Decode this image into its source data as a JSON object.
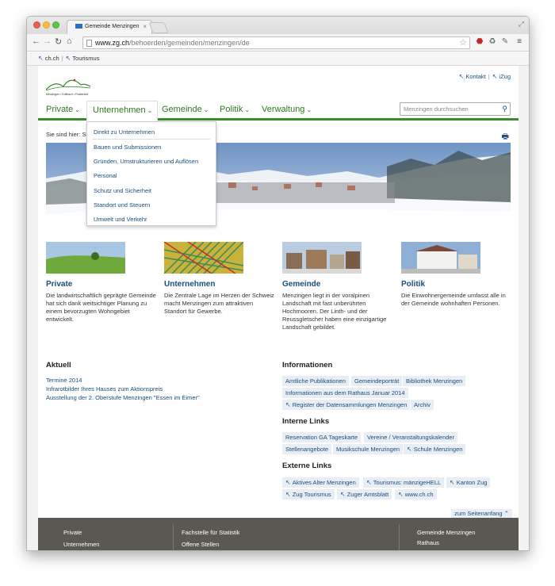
{
  "browser": {
    "tab_title": "Gemeinde Menzingen",
    "url_host": "www.zg.ch",
    "url_path": "/behoerden/gemeinden/menzingen/de"
  },
  "bookmarks": [
    {
      "label": "ch.ch"
    },
    {
      "label": "Tourismus"
    }
  ],
  "logo": {
    "text": "Menzingen • Edlibach • Finstersee"
  },
  "toplinks": [
    {
      "label": "Kontakt"
    },
    {
      "label": "iZug"
    }
  ],
  "nav": {
    "items": [
      {
        "label": "Private"
      },
      {
        "label": "Unternehmen"
      },
      {
        "label": "Gemeinde"
      },
      {
        "label": "Politik"
      },
      {
        "label": "Verwaltung"
      }
    ],
    "search_placeholder": "Menzingen durchsuchen"
  },
  "breadcrumb": "Sie sind hier: S",
  "dropdown": {
    "items": [
      "Direkt zu Unternehmen",
      "Bauen und Submissionen",
      "Gründen, Umstrukturieren und Auflösen",
      "Personal",
      "Schutz und Sicherheit",
      "Standort und Steuern",
      "Umwelt und Verkehr"
    ]
  },
  "teasers": [
    {
      "title": "Private",
      "text": "Die landwirtschaftlich geprägte Gemeinde hat sich dank weitsichtiger Planung zu einem bevorzugten Wohngebiet entwickelt."
    },
    {
      "title": "Unternehmen",
      "text": "Die Zentrale Lage im Herzen der Schweiz macht Menzingen zum attraktiven Standort für Gewerbe."
    },
    {
      "title": "Gemeinde",
      "text": "Menzingen liegt in der voralpinen Landschaft mit fast unberührten Hochmooren. Der Linth- und der Reussgletscher haben eine einzigartige Landschaft gebildet."
    },
    {
      "title": "Politik",
      "text": "Die Einwohnergemeinde umfasst alle in der Gemeinde wohnhaften Personen."
    }
  ],
  "aktuell": {
    "heading": "Aktuell",
    "items": [
      "Termine 2014",
      "Infrarotbilder Ihres Hauses zum Aktionspreis",
      "Ausstellung der 2. Oberstufe Menzingen \"Essen im Eimer\""
    ]
  },
  "informationen": {
    "heading": "Informationen",
    "items": [
      "Amtliche Publikationen",
      "Gemeindeporträt",
      "Bibliothek Menzingen",
      "Informationen aus dem Rathaus Januar 2014",
      "Register der Datensammlungen Menzingen",
      "Archiv"
    ]
  },
  "interne_links": {
    "heading": "Interne Links",
    "items": [
      "Reservation GA Tageskarte",
      "Vereine / Veranstaltungskalender",
      "Stellenangebote",
      "Musikschule Menzingen",
      "Schule Menzingen"
    ]
  },
  "externe_links": {
    "heading": "Externe Links",
    "items": [
      "Aktives Alter Menzingen",
      "Tourismus: mänzigeHELL",
      "Kanton Zug",
      "Zug Tourismus",
      "Zuger Amtsblatt",
      "www.ch.ch"
    ]
  },
  "to_top": "zum Seitenanfang",
  "footer": {
    "col1": [
      "Private",
      "Unternehmen"
    ],
    "col2": [
      "Fachstelle für Statistik",
      "Offene Stellen"
    ],
    "col3": [
      "Gemeinde Menzingen",
      "Rathaus"
    ]
  },
  "colors": {
    "nav_green": "#2e7a23",
    "link_blue": "#1a4d7c",
    "footer_bg": "#5a5852"
  }
}
